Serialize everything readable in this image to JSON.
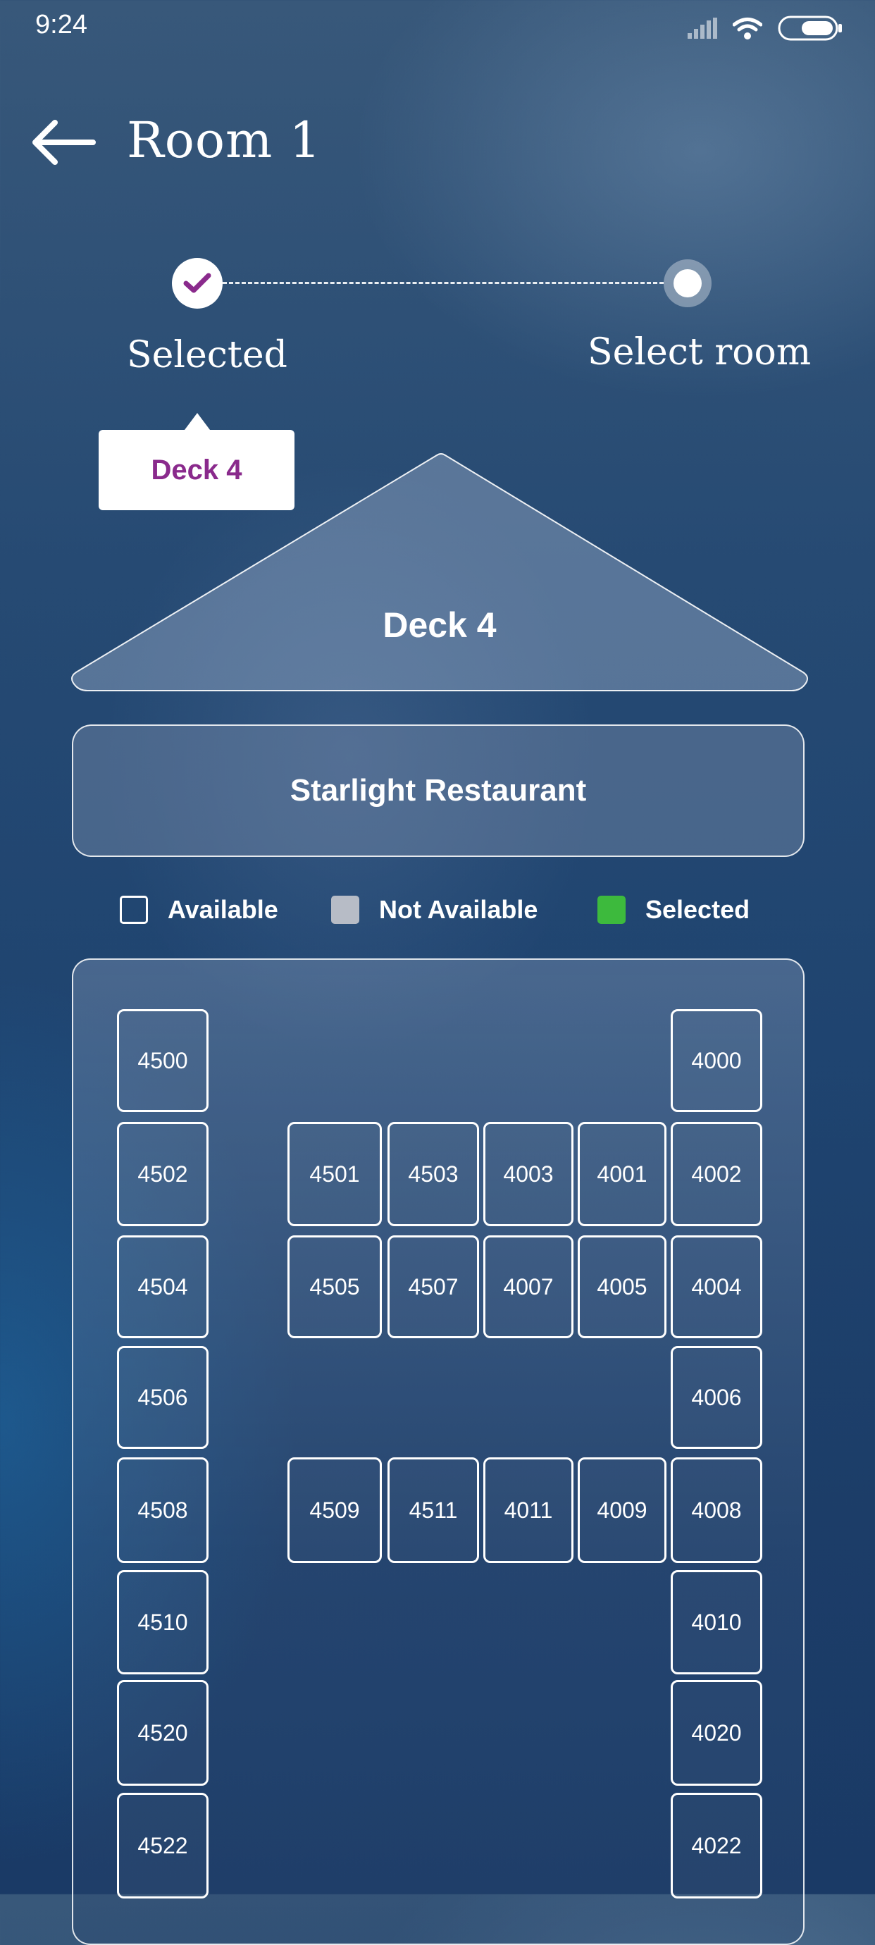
{
  "status_bar": {
    "time": "9:24",
    "icons": [
      "signal-icon",
      "wifi-icon",
      "battery-icon"
    ]
  },
  "header": {
    "title": "Room 1",
    "back_icon": "arrow-left-icon"
  },
  "stepper": {
    "steps": [
      {
        "label": "Selected",
        "state": "done"
      },
      {
        "label": "Select room",
        "state": "active"
      }
    ]
  },
  "tooltip": {
    "label": "Deck 4"
  },
  "deck": {
    "label": "Deck 4"
  },
  "restaurant": {
    "label": "Starlight Restaurant"
  },
  "legend": {
    "items": [
      {
        "label": "Available",
        "color": "#ffffff"
      },
      {
        "label": "Not Available",
        "color": "#b7bcc6"
      },
      {
        "label": "Selected",
        "color": "#3dba3d"
      }
    ]
  },
  "cabins": {
    "left_column": [
      "4500",
      "4502",
      "4504",
      "4506",
      "4508",
      "4510",
      "4520",
      "4522"
    ],
    "right_column": [
      "4000",
      "4002",
      "4004",
      "4006",
      "4008",
      "4010",
      "4020",
      "4022"
    ],
    "middle_block_1_row_1": [
      "4501",
      "4503",
      "4003",
      "4001"
    ],
    "middle_block_1_row_2": [
      "4505",
      "4507",
      "4007",
      "4005"
    ],
    "middle_block_2_row_1": [
      "4509",
      "4511",
      "4011",
      "4009"
    ]
  },
  "colors": {
    "accent_purple": "#8a2a8c",
    "selected_green": "#3dba3d",
    "not_available_gray": "#b7bcc6"
  }
}
